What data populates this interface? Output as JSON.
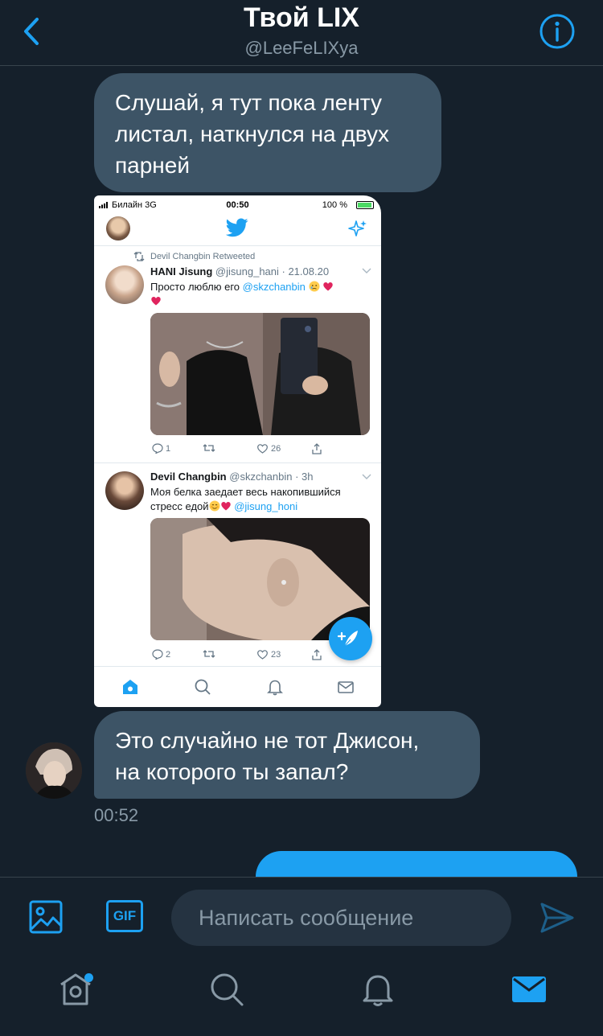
{
  "colors": {
    "background": "#15202b",
    "bubble_incoming": "#3d5466",
    "accent": "#1da1f2",
    "secondary_text": "#8899a6",
    "divider": "#38444d"
  },
  "header": {
    "back_icon": "chevron-left-icon",
    "title": "Твой LIX",
    "handle": "@LeeFeLIXya",
    "info_icon": "info-icon"
  },
  "messages": {
    "first": {
      "lines": [
        "Слушай, я тут пока ленту",
        "листал, наткнулся на двух",
        "парней"
      ]
    },
    "second": {
      "lines": [
        "Это случайно не тот Джисон,",
        "на которого ты запал?"
      ],
      "timestamp": "00:52"
    }
  },
  "screenshot": {
    "status_bar": {
      "carrier": "Билайн  3G",
      "time": "00:50",
      "battery": "100 %"
    },
    "tweet1": {
      "retweeted_by": "Devil Changbin  Retweeted",
      "name": "HANI Jisung",
      "meta": "@jisung_hani · 21.08.20",
      "text_prefix": "Просто люблю его ",
      "mention": "@skzchanbin",
      "replies": "1",
      "likes": "26"
    },
    "tweet2": {
      "name": "Devil Changbin",
      "meta": "@skzchanbin · 3h",
      "text_line1": "Моя белка заедает весь накопившийся",
      "text_line2_prefix": "стресс едой",
      "mention": "@jisung_honi",
      "replies": "2",
      "likes": "23"
    },
    "tabs": [
      "home-icon",
      "search-icon",
      "bell-icon",
      "mail-icon"
    ]
  },
  "composer": {
    "placeholder": "Написать сообщение",
    "media_icon": "image-icon",
    "gif_label": "GIF",
    "send_icon": "send-icon"
  },
  "bottom_nav": [
    "home-icon",
    "search-icon",
    "bell-icon",
    "mail-icon"
  ]
}
